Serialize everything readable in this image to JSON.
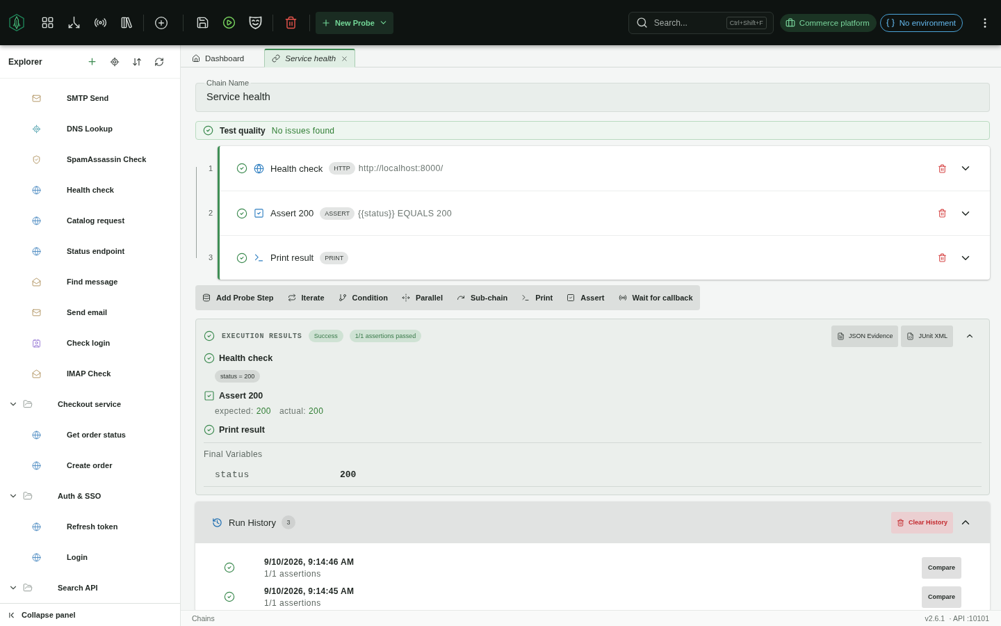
{
  "top_bar": {
    "new_probe": "New Probe",
    "search": {
      "placeholder": "Search...",
      "shortcut": "Ctrl+Shift+F"
    },
    "workspace": "Commerce platform",
    "environment": "No environment"
  },
  "sidebar": {
    "title": "Explorer",
    "items": [
      {
        "label": "SMTP Send",
        "kind": "smtp"
      },
      {
        "label": "DNS Lookup",
        "kind": "dns"
      },
      {
        "label": "SpamAssassin Check",
        "kind": "spam"
      },
      {
        "label": "Health check",
        "kind": "http"
      },
      {
        "label": "Catalog request",
        "kind": "http"
      },
      {
        "label": "Status endpoint",
        "kind": "http"
      },
      {
        "label": "Find message",
        "kind": "imap"
      },
      {
        "label": "Send email",
        "kind": "smtp"
      },
      {
        "label": "Check login",
        "kind": "login"
      },
      {
        "label": "IMAP Check",
        "kind": "imap"
      },
      {
        "label": "Checkout service",
        "kind": "folder",
        "expanded": true,
        "children": [
          {
            "label": "Get order status",
            "kind": "http"
          },
          {
            "label": "Create order",
            "kind": "http"
          }
        ]
      },
      {
        "label": "Auth & SSO",
        "kind": "folder",
        "expanded": true,
        "children": [
          {
            "label": "Refresh token",
            "kind": "http"
          },
          {
            "label": "Login",
            "kind": "http"
          }
        ]
      },
      {
        "label": "Search API",
        "kind": "folder",
        "expanded": true
      }
    ],
    "collapse": "Collapse panel"
  },
  "tabs": [
    {
      "label": "Dashboard",
      "kind": "home",
      "selected": false
    },
    {
      "label": "Service health",
      "kind": "chain",
      "selected": true
    }
  ],
  "chain_name": {
    "label": "Chain Name",
    "value": "Service health"
  },
  "test_quality": {
    "label": "Test quality",
    "message": "No issues found",
    "passed": true
  },
  "steps": [
    {
      "number": "1",
      "name": "Health check",
      "kind": "http",
      "badge": "HTTP",
      "detail": "http://localhost:8000/",
      "passed": true
    },
    {
      "number": "2",
      "name": "Assert 200",
      "kind": "assert",
      "badge": "ASSERT",
      "detail": "{{status}} EQUALS 200",
      "passed": true
    },
    {
      "number": "3",
      "name": "Print result",
      "kind": "print",
      "badge": "PRINT",
      "passed": true
    }
  ],
  "step_actions": [
    {
      "label": "Add Probe Step",
      "kind": "probe"
    },
    {
      "label": "Iterate",
      "kind": "iterate"
    },
    {
      "label": "Condition",
      "kind": "condition"
    },
    {
      "label": "Parallel",
      "kind": "parallel"
    },
    {
      "label": "Sub-chain",
      "kind": "subchain"
    },
    {
      "label": "Print",
      "kind": "print"
    },
    {
      "label": "Assert",
      "kind": "assert"
    },
    {
      "label": "Wait for callback",
      "kind": "callback"
    }
  ],
  "execution_results": {
    "title": "EXECUTION RESULTS",
    "passed": true,
    "status": "Success",
    "assertions": "1/1 assertions passed",
    "exports": [
      {
        "label": "JSON Evidence",
        "kind": "json"
      },
      {
        "label": "JUnit XML",
        "kind": "xml"
      }
    ],
    "expanded": true,
    "steps": [
      {
        "name": "Health check",
        "kind": "request",
        "passed": true,
        "chips": [
          "status = 200"
        ]
      },
      {
        "name": "Assert 200",
        "kind": "assert",
        "passed": true,
        "expected_label": "expected:",
        "expected": "200",
        "actual_label": "actual:",
        "actual": "200"
      },
      {
        "name": "Print result",
        "kind": "print",
        "passed": true
      }
    ],
    "final_variables": {
      "title": "Final Variables",
      "rows": [
        {
          "name": "status",
          "value": "200"
        }
      ]
    }
  },
  "run_history": {
    "title": "Run History",
    "count": "3",
    "clear": "Clear History",
    "expanded": true,
    "runs": [
      {
        "time": "9/10/2026, 9:14:46 AM",
        "summary": "1/1 assertions",
        "passed": true,
        "action": "Compare"
      },
      {
        "time": "9/10/2026, 9:14:45 AM",
        "summary": "1/1 assertions",
        "passed": true,
        "action": "Compare"
      }
    ]
  },
  "status_bar": {
    "section": "Chains",
    "version": "v2.6.1",
    "api": "· API :10101"
  }
}
